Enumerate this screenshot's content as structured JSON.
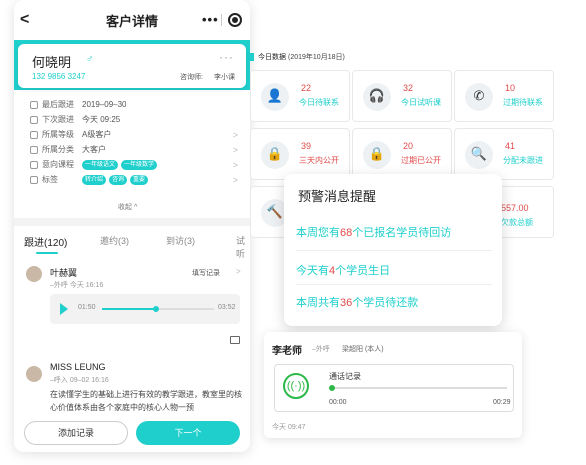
{
  "phone": {
    "header_title": "客户详情",
    "back_glyph": "<",
    "more_glyph": "•••",
    "customer": {
      "name": "何晓明",
      "gender_glyph": "♂",
      "phone": "132 9856 3247",
      "card_more": "···",
      "consultant_label": "咨询师:",
      "consultant": "李小课"
    },
    "info_rows": [
      {
        "label": "最后跟进",
        "value": "2019–09–30",
        "arrow": ""
      },
      {
        "label": "下次跟进",
        "value": "今天 09:25",
        "arrow": ""
      },
      {
        "label": "所属等级",
        "value": "A级客户",
        "arrow": ">"
      },
      {
        "label": "所属分类",
        "value": "大客户",
        "arrow": ">"
      },
      {
        "label": "意向课程",
        "value": "",
        "arrow": ">"
      },
      {
        "label": "标签",
        "value": "",
        "arrow": ">"
      }
    ],
    "course_tags": [
      "一年级语文",
      "一年级数学"
    ],
    "label_tags": [
      "转介绍",
      "咨询",
      "重要"
    ],
    "collapse_label": "收起 ^",
    "tabs": [
      "跟进(120)",
      "邀约(3)",
      "到访(3)",
      "试听"
    ],
    "follow_ups": [
      {
        "name": "叶赫翼",
        "meta": "–外呼   今天 16:16",
        "action": "填写记录",
        "action_arrow": ">"
      },
      {
        "name": "MISS LEUNG",
        "meta": "–呼入   09–02 16:16",
        "text": "在读懂学生的基础上进行有效的教学跟进，教室里的核心价值体系由各个家庭中的核心人物一预"
      }
    ],
    "audio": {
      "start": "01:50",
      "end": "03:52",
      "progress": 0.48
    },
    "buttons": {
      "add": "添加记录",
      "next": "下一个"
    }
  },
  "today": {
    "title": "今日数据",
    "date": "(2019年10月18日)",
    "stats": [
      {
        "icon": "person-icon",
        "glyph": "👤",
        "count": "22",
        "label": "今日待联系"
      },
      {
        "icon": "headset-icon",
        "glyph": "🎧",
        "count": "32",
        "label": "今日试听课"
      },
      {
        "icon": "missed-call-icon",
        "glyph": "✆",
        "count": "10",
        "label": "过期待联系"
      },
      {
        "icon": "lock-icon",
        "glyph": "🔒",
        "count": "39",
        "label": "三天内公开"
      },
      {
        "icon": "lock-icon",
        "glyph": "🔒",
        "count": "20",
        "label": "过期已公开"
      },
      {
        "icon": "search-icon",
        "glyph": "🔍",
        "count": "41",
        "label": "分配未跟进"
      },
      {
        "icon": "gavel-icon",
        "glyph": "🔨",
        "count": "",
        "label": ""
      },
      {
        "icon": "",
        "glyph": "",
        "count": "557.00",
        "label": "欠款总额"
      }
    ],
    "colors": {
      "accent": "#1fcfcc",
      "alert": "#e04a4a"
    }
  },
  "alert": {
    "title": "预警消息提醒",
    "lines": [
      {
        "pre": "本周您有",
        "num": "68",
        "post": "个已报名学员待回访"
      },
      {
        "pre": "今天有",
        "num": "4",
        "post": "个学员生日"
      },
      {
        "pre": "本周共有",
        "num": "36",
        "post": "个学员待还款"
      }
    ]
  },
  "call": {
    "teacher": "李老师",
    "type": "–外呼",
    "who": "梁超阳 (本人)",
    "icon_glyph": "((·))",
    "title": "通话记录",
    "start": "00:00",
    "end": "00:29",
    "progress": 0.0,
    "time": "今天 09:47"
  }
}
